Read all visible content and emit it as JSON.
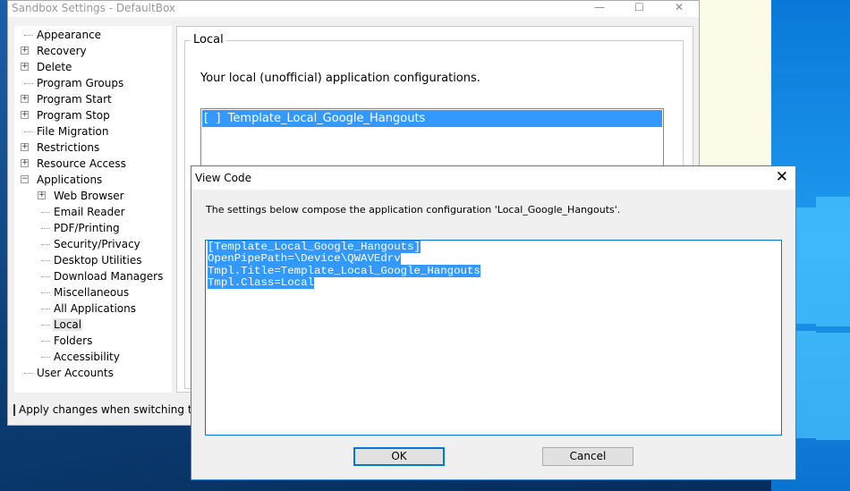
{
  "window": {
    "title": "Sandbox Settings - DefaultBox",
    "minimize": "—",
    "maximize": "☐",
    "close": "✕"
  },
  "tree": [
    {
      "label": "Appearance",
      "level": 0,
      "toggle": ""
    },
    {
      "label": "Recovery",
      "level": 0,
      "toggle": "+"
    },
    {
      "label": "Delete",
      "level": 0,
      "toggle": "+"
    },
    {
      "label": "Program Groups",
      "level": 0,
      "toggle": ""
    },
    {
      "label": "Program Start",
      "level": 0,
      "toggle": "+"
    },
    {
      "label": "Program Stop",
      "level": 0,
      "toggle": "+"
    },
    {
      "label": "File Migration",
      "level": 0,
      "toggle": ""
    },
    {
      "label": "Restrictions",
      "level": 0,
      "toggle": "+"
    },
    {
      "label": "Resource Access",
      "level": 0,
      "toggle": "+"
    },
    {
      "label": "Applications",
      "level": 0,
      "toggle": "−"
    },
    {
      "label": "Web Browser",
      "level": 1,
      "toggle": "+"
    },
    {
      "label": "Email Reader",
      "level": 1,
      "toggle": ""
    },
    {
      "label": "PDF/Printing",
      "level": 1,
      "toggle": ""
    },
    {
      "label": "Security/Privacy",
      "level": 1,
      "toggle": ""
    },
    {
      "label": "Desktop Utilities",
      "level": 1,
      "toggle": ""
    },
    {
      "label": "Download Managers",
      "level": 1,
      "toggle": ""
    },
    {
      "label": "Miscellaneous",
      "level": 1,
      "toggle": ""
    },
    {
      "label": "All Applications",
      "level": 1,
      "toggle": ""
    },
    {
      "label": "Local",
      "level": 1,
      "toggle": "",
      "selected": true
    },
    {
      "label": "Folders",
      "level": 1,
      "toggle": ""
    },
    {
      "label": "Accessibility",
      "level": 1,
      "toggle": ""
    },
    {
      "label": "User Accounts",
      "level": 0,
      "toggle": ""
    }
  ],
  "panel": {
    "group_label": "Local",
    "description": "Your local (unofficial) application configurations.",
    "list_items": [
      "[  ]  Template_Local_Google_Hangouts"
    ]
  },
  "apply_checkbox": {
    "label": "Apply changes when switching to another page",
    "checked": false
  },
  "dialog": {
    "title": "View Code",
    "close": "✕",
    "description": "The settings below compose the application configuration 'Local_Google_Hangouts'.",
    "code_lines": [
      "[Template_Local_Google_Hangouts]",
      "OpenPipePath=\\Device\\QWAVEdrv",
      "Tmpl.Title=Template_Local_Google_Hangouts",
      "Tmpl.Class=Local"
    ],
    "ok_label": "OK",
    "cancel_label": "Cancel"
  },
  "colors": {
    "selection": "#3399ff",
    "accent": "#0078d7"
  }
}
